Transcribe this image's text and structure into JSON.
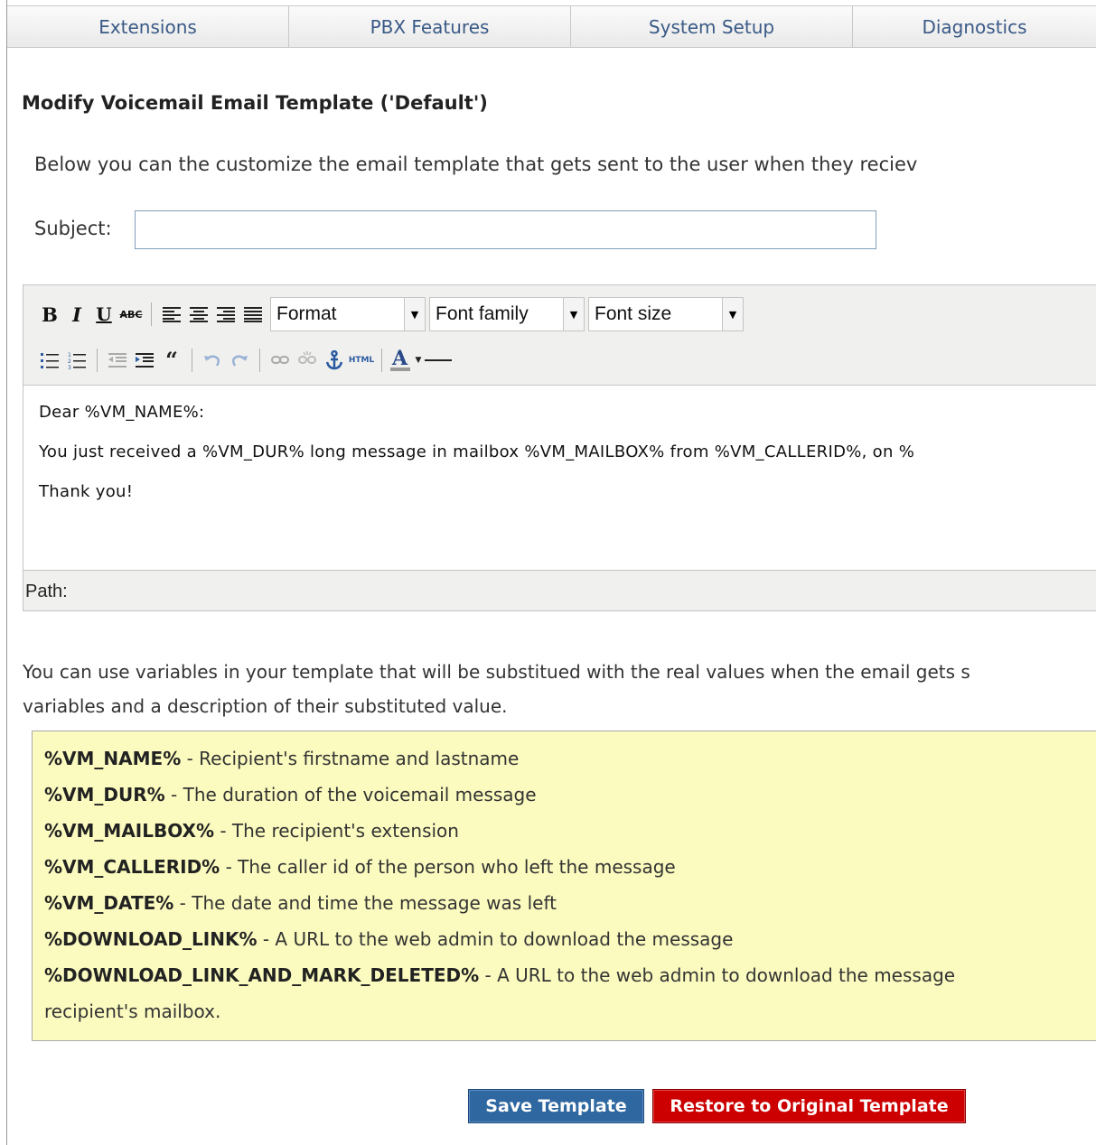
{
  "tabs": [
    "Extensions",
    "PBX Features",
    "System Setup",
    "Diagnostics"
  ],
  "page_title": "Modify Voicemail Email Template ('Default')",
  "intro_text": "Below you can the customize the email template that gets sent to the user when they reciev",
  "subject": {
    "label": "Subject:",
    "value": ""
  },
  "editor": {
    "format_select": "Format",
    "font_family_select": "Font family",
    "font_size_select": "Font size",
    "html_button": "HTML",
    "body_lines": [
      "Dear %VM_NAME%:",
      "You just received a %VM_DUR% long message in mailbox %VM_MAILBOX% from %VM_CALLERID%, on %",
      "Thank you!"
    ],
    "path_label": "Path:"
  },
  "variables_intro": {
    "line1": "You can use variables in your template that will be substitued with the real values when the email gets s",
    "line2": "variables and a description of their substituted value."
  },
  "variables": [
    {
      "name": "%VM_NAME%",
      "desc": " - Recipient's firstname and lastname"
    },
    {
      "name": "%VM_DUR%",
      "desc": " - The duration of the voicemail message"
    },
    {
      "name": "%VM_MAILBOX%",
      "desc": " - The recipient's extension"
    },
    {
      "name": "%VM_CALLERID%",
      "desc": " - The caller id of the person who left the message"
    },
    {
      "name": "%VM_DATE%",
      "desc": " - The date and time the message was left"
    },
    {
      "name": "%DOWNLOAD_LINK%",
      "desc": " - A URL to the web admin to download the message"
    },
    {
      "name": "%DOWNLOAD_LINK_AND_MARK_DELETED%",
      "desc": " - A URL to the web admin to download the message"
    }
  ],
  "variables_tail": "recipient's mailbox.",
  "buttons": {
    "save": "Save Template",
    "restore": "Restore to Original Template"
  },
  "colors": {
    "save_button": "#2f67a0",
    "restore_button": "#cc0000",
    "variables_box": "#fbfbbf",
    "tab_text": "#3a5a86"
  }
}
